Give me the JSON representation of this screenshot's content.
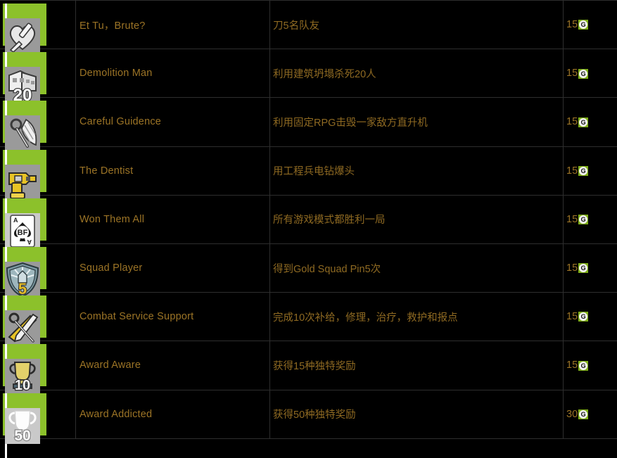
{
  "theme": {
    "background": "#000000",
    "grid_line": "#2e2e2e",
    "name_text": "#9c7426",
    "desc_text": "#8f6a22",
    "points_text": "#9c7426",
    "badge_accent_green": "#8cc12b",
    "gamerscore_green": "#7fae18"
  },
  "gamerscore": {
    "icon_name": "gamerscore-g-icon",
    "icon_letter": "G"
  },
  "achievements": [
    {
      "icon_name": "heart-knife-badge-icon",
      "icon_art": "heart-dagger",
      "name": "Et Tu，Brute?",
      "description": "刀5名队友",
      "points": "15"
    },
    {
      "icon_name": "demolition-20-badge-icon",
      "icon_art": "building-20",
      "name": "Demolition Man",
      "description": "利用建筑坍塌杀死20人",
      "points": "15"
    },
    {
      "icon_name": "winged-rpg-badge-icon",
      "icon_art": "winged-rocket",
      "name": "Careful Guidence",
      "description": "利用固定RPG击毁一家敌方直升机",
      "points": "15"
    },
    {
      "icon_name": "power-drill-badge-icon",
      "icon_art": "drill",
      "name": "The Dentist",
      "description": "用工程兵电钻爆头",
      "points": "15"
    },
    {
      "icon_name": "ace-of-spades-bf-badge-icon",
      "icon_art": "ace-card",
      "name": "Won Them All",
      "description": "所有游戏模式都胜利一局",
      "points": "15"
    },
    {
      "icon_name": "squad-pin-5-badge-icon",
      "icon_art": "squad-pin",
      "name": "Squad Player",
      "description": "得到Gold Squad Pin5次",
      "points": "15"
    },
    {
      "icon_name": "wrench-knife-badge-icon",
      "icon_art": "multi-tool",
      "name": "Combat Service Support",
      "description": "完成10次补给，修理，治疗，救护和报点",
      "points": "15"
    },
    {
      "icon_name": "trophy-10-badge-icon",
      "icon_art": "trophy-10",
      "name": "Award Aware",
      "description": "获得15种独特奖励",
      "points": "15"
    },
    {
      "icon_name": "trophy-50-badge-icon",
      "icon_art": "trophy-50",
      "name": "Award Addicted",
      "description": "获得50种独特奖励",
      "points": "30"
    }
  ]
}
